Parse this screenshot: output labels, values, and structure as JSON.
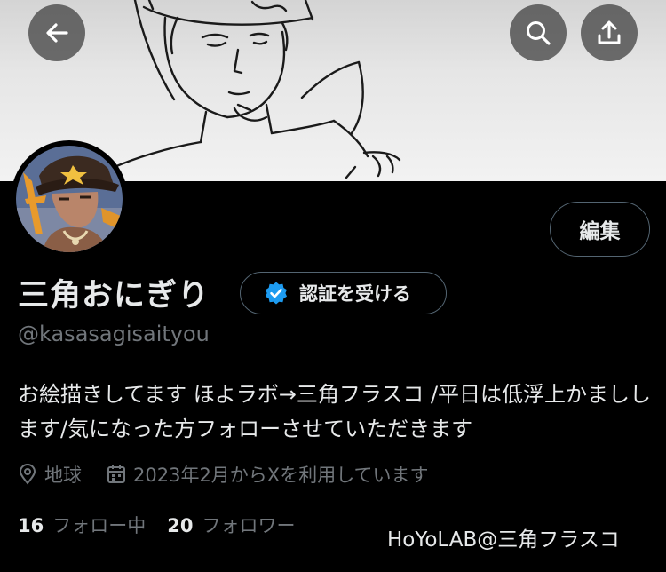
{
  "header": {
    "back_icon": "arrow-left-icon",
    "search_icon": "search-icon",
    "share_icon": "share-icon"
  },
  "profile": {
    "display_name": "三角おにぎり",
    "verify_label": "認証を受ける",
    "handle": "@kasasagisaityou",
    "edit_label": "編集",
    "bio": "お絵描きしてます ほよラボ→三角フラスコ /平日は低浮上かましします/気になった方フォローさせていただきます",
    "location": "地球",
    "joined": "2023年2月からXを利用しています",
    "following_count": "16",
    "following_label": "フォロー中",
    "followers_count": "20",
    "followers_label": "フォロワー"
  },
  "watermark": "HoYoLAB@三角フラスコ",
  "colors": {
    "background": "#000000",
    "text_primary": "#e7e9ea",
    "text_secondary": "#71767b",
    "border": "#536471",
    "verified_blue": "#1d9bf0"
  }
}
